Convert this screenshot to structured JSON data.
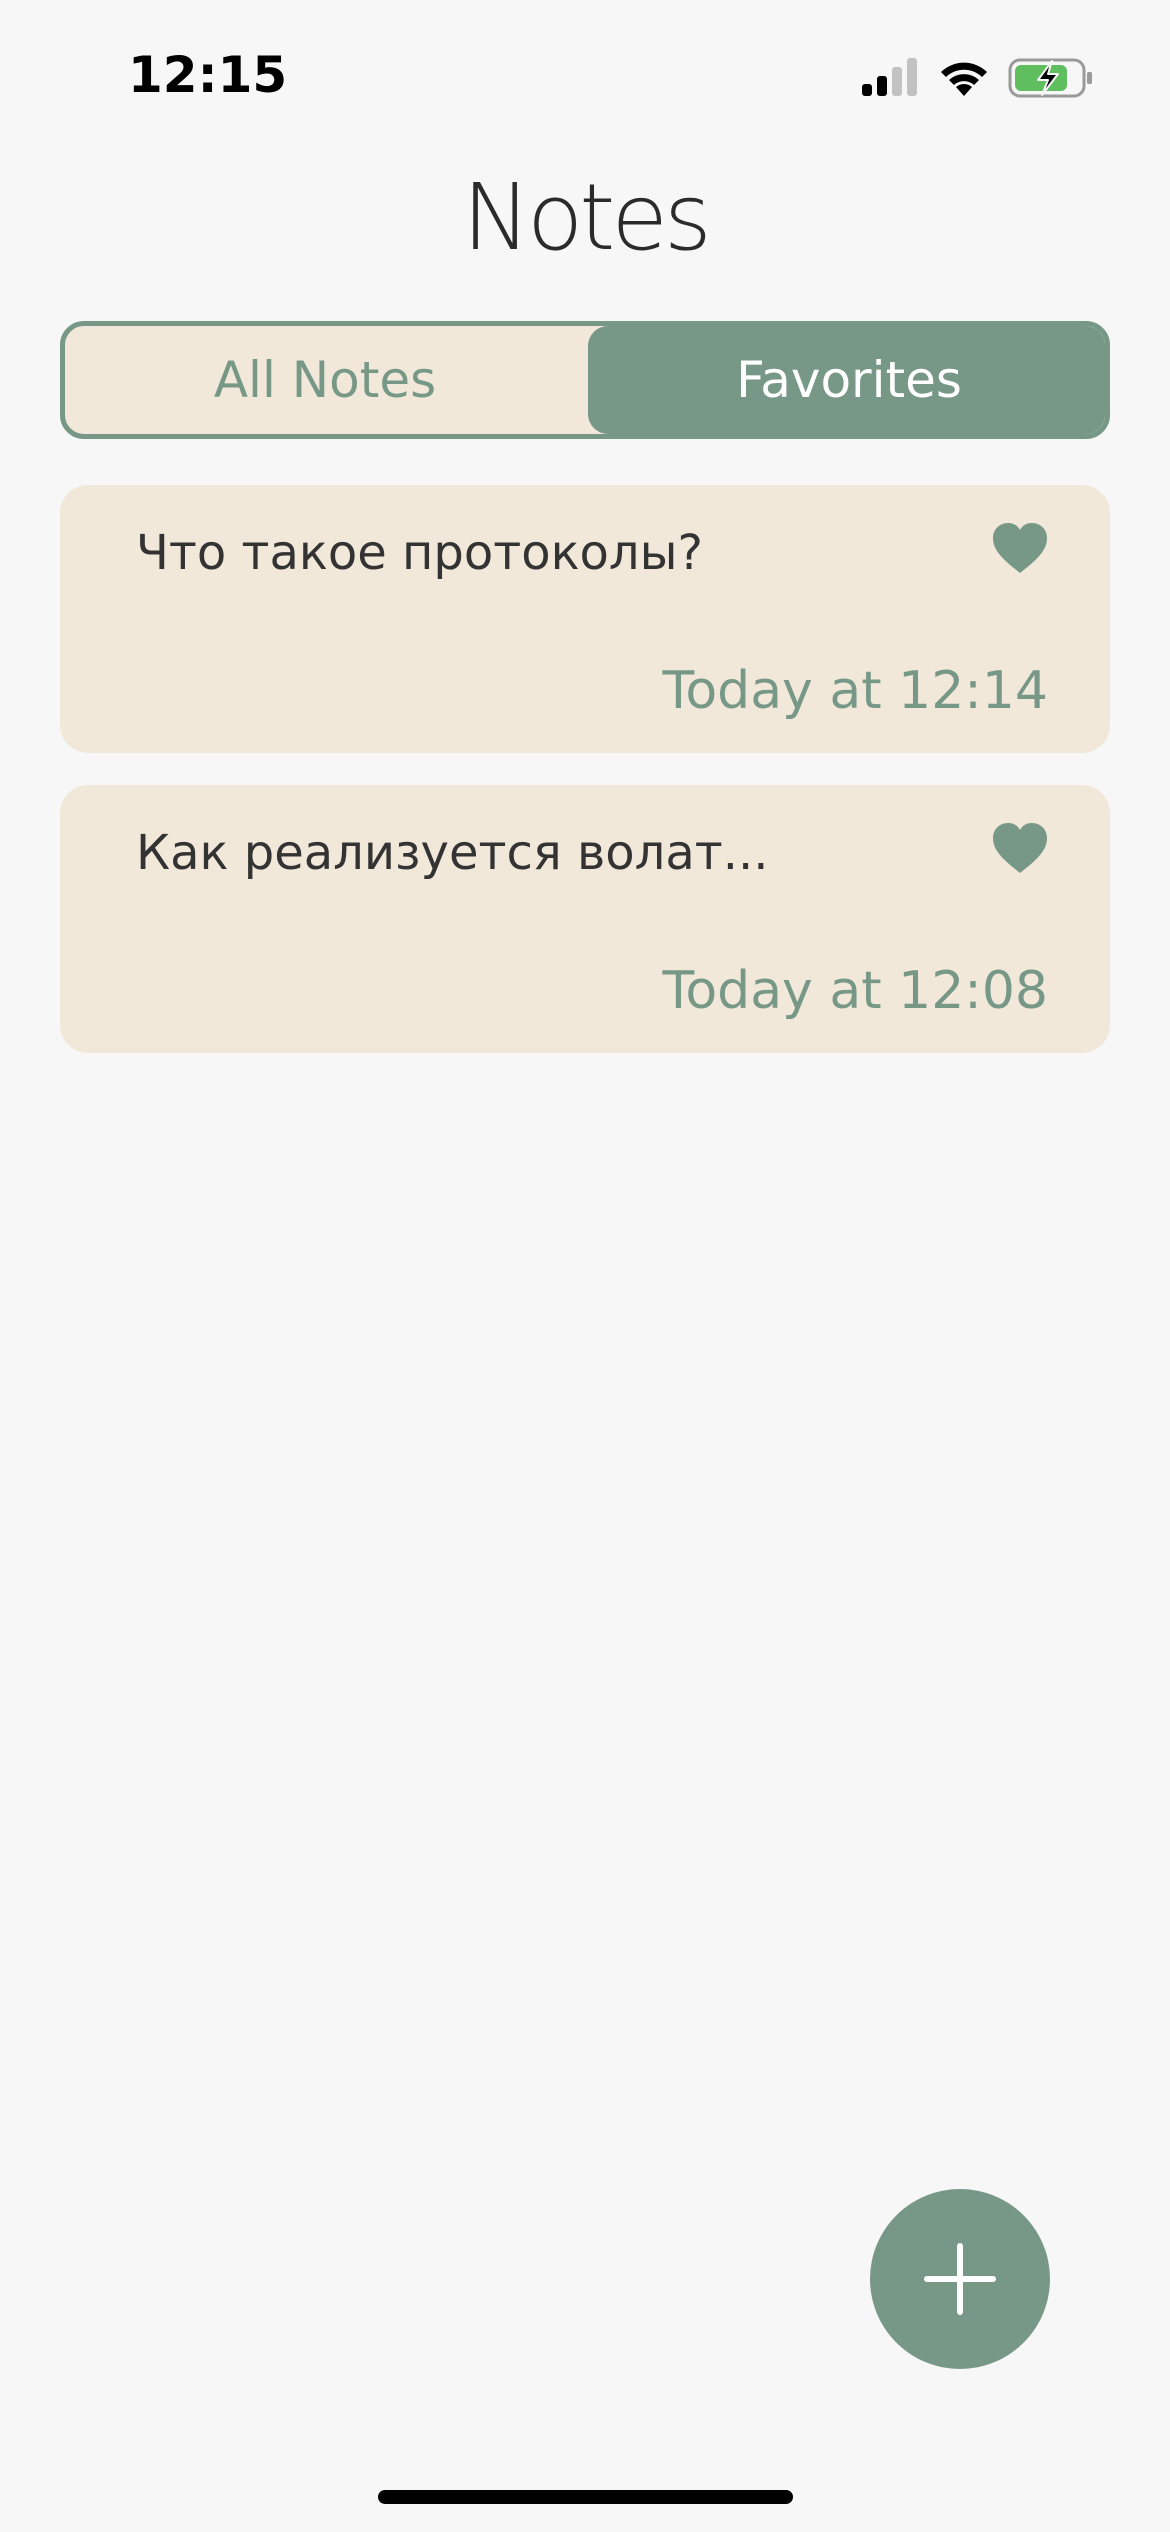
{
  "status_bar": {
    "time": "12:15"
  },
  "header": {
    "title": "Notes"
  },
  "segmented_control": {
    "options": [
      "All Notes",
      "Favorites"
    ],
    "selected": "Favorites"
  },
  "notes": [
    {
      "title": "Что такое протоколы?",
      "date": "Today at 12:14",
      "favorite": true
    },
    {
      "title": "Как реализуется волат...",
      "date": "Today at 12:08",
      "favorite": true
    }
  ],
  "theme": {
    "accent": "#789887",
    "card_background": "#f1e8da",
    "page_background": "#f7f7f7"
  },
  "icons": {
    "signal": "cellular-signal-icon",
    "wifi": "wifi-icon",
    "battery": "battery-charging-icon",
    "heart": "heart-icon",
    "add": "plus-icon"
  }
}
